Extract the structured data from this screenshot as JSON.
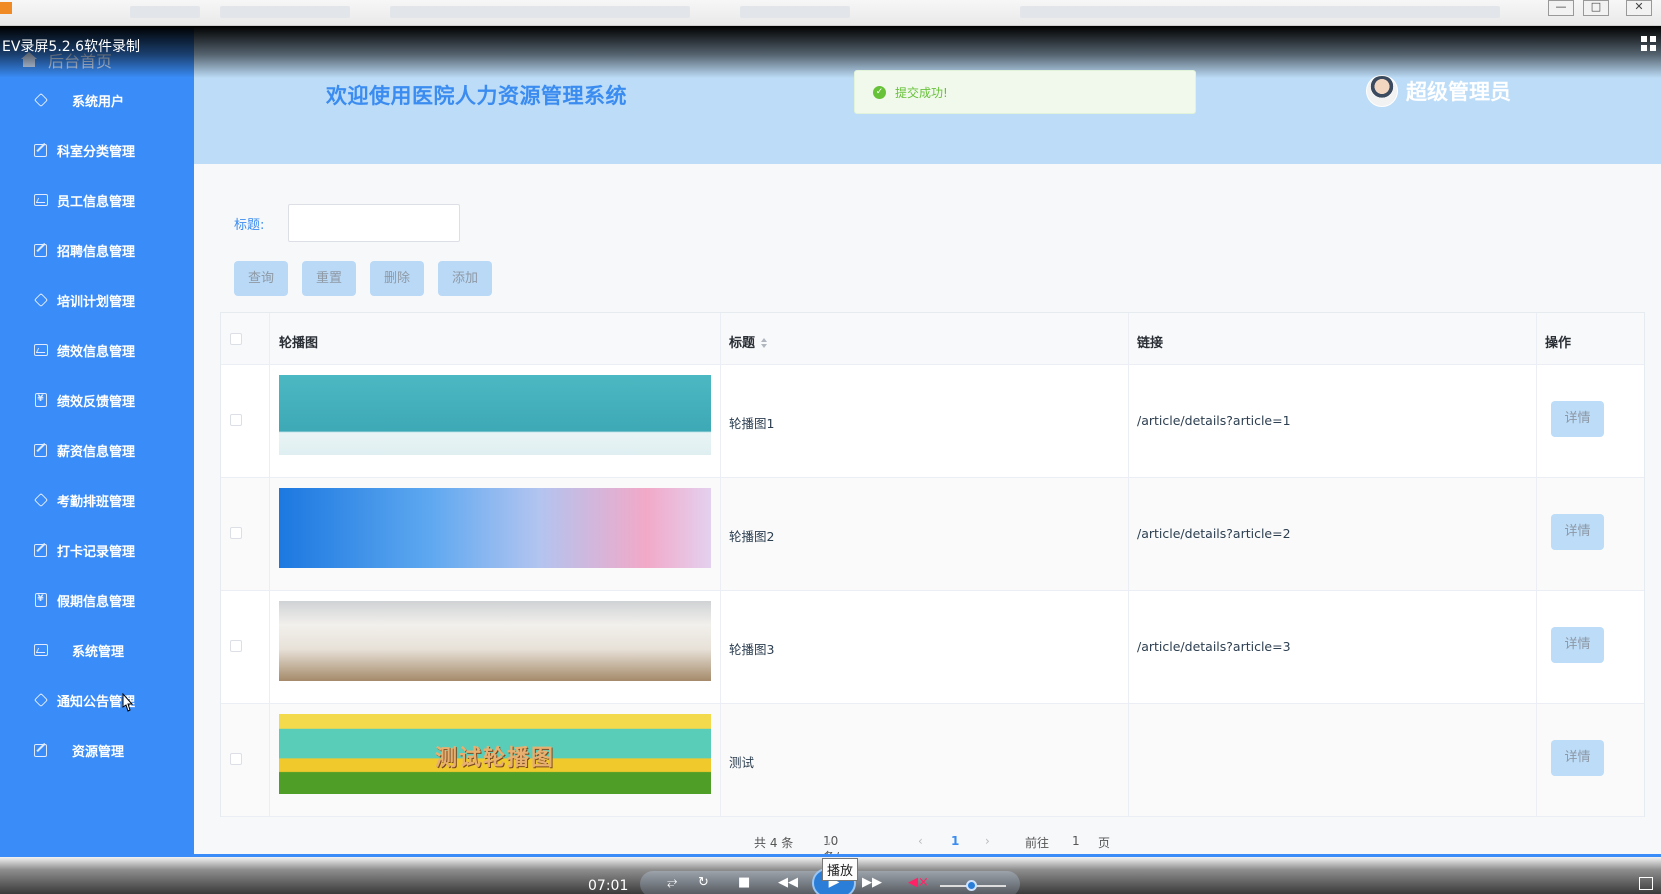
{
  "recorder": {
    "label": "EV录屏5.2.6软件录制",
    "time": "07:01",
    "tooltip": "播放"
  },
  "sidebar": {
    "home_label": "后台首页",
    "items": [
      {
        "label": "系统用户",
        "icon": "diamond-icon",
        "centered": true
      },
      {
        "label": "科室分类管理",
        "icon": "edit-icon"
      },
      {
        "label": "员工信息管理",
        "icon": "chart-icon"
      },
      {
        "label": "招聘信息管理",
        "icon": "edit-icon"
      },
      {
        "label": "培训计划管理",
        "icon": "diamond-icon"
      },
      {
        "label": "绩效信息管理",
        "icon": "chart-icon"
      },
      {
        "label": "绩效反馈管理",
        "icon": "money-icon"
      },
      {
        "label": "薪资信息管理",
        "icon": "edit-icon"
      },
      {
        "label": "考勤排班管理",
        "icon": "diamond-icon"
      },
      {
        "label": "打卡记录管理",
        "icon": "edit-icon"
      },
      {
        "label": "假期信息管理",
        "icon": "money-icon"
      },
      {
        "label": "系统管理",
        "icon": "chart-icon",
        "centered": true
      },
      {
        "label": "通知公告管理",
        "icon": "diamond-icon"
      },
      {
        "label": "资源管理",
        "icon": "edit-icon",
        "centered": true
      }
    ]
  },
  "header": {
    "title": "欢迎使用医院人力资源管理系统",
    "user_name": "超级管理员",
    "toast": "提交成功!"
  },
  "search": {
    "label": "标题:",
    "value": "",
    "placeholder": ""
  },
  "buttons": {
    "query": "查询",
    "reset": "重置",
    "delete": "删除",
    "add": "添加"
  },
  "table": {
    "headers": {
      "banner": "轮播图",
      "title": "标题",
      "link": "链接",
      "action": "操作"
    },
    "rows": [
      {
        "title": "轮播图1",
        "link": "/article/details?article=1",
        "action": "详情",
        "banner_overlay": ""
      },
      {
        "title": "轮播图2",
        "link": "/article/details?article=2",
        "action": "详情",
        "banner_overlay": ""
      },
      {
        "title": "轮播图3",
        "link": "/article/details?article=3",
        "action": "详情",
        "banner_overlay": ""
      },
      {
        "title": "测试",
        "link": "",
        "action": "详情",
        "banner_overlay": "测试轮播图"
      }
    ]
  },
  "pager": {
    "total": "共 4 条",
    "page_size": "10条/页",
    "current": "1",
    "goto_prefix": "前往",
    "goto_value": "1",
    "goto_suffix": "页"
  },
  "colors": {
    "sidebar": "#3a8df8",
    "header": "#bcdcf7",
    "accent": "#3b8cf0",
    "success": "#67c23a"
  }
}
